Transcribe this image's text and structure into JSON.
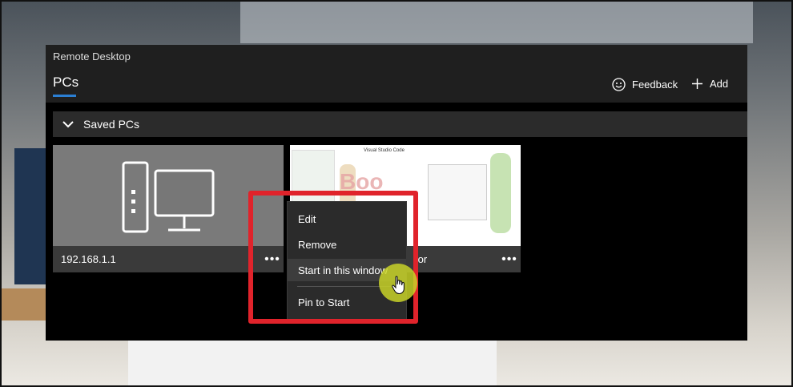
{
  "window": {
    "title": "Remote Desktop"
  },
  "header": {
    "tab": "PCs",
    "feedback_label": "Feedback",
    "add_label": "Add"
  },
  "group": {
    "label": "Saved PCs"
  },
  "tiles": [
    {
      "label": "192.168.1.1",
      "more": "•••"
    },
    {
      "label": "tor",
      "more": "•••"
    }
  ],
  "thumbnail": {
    "title": "Visual Studio Code",
    "brand": "Boo"
  },
  "context_menu": {
    "items": [
      "Edit",
      "Remove",
      "Start in this window",
      "Pin to Start"
    ],
    "hovered": "Start in this window"
  },
  "colors": {
    "accent": "#2b7fd3",
    "highlight": "#e0232b",
    "cursor_glow": "#c8d228"
  },
  "icons": [
    "feedback-smile-icon",
    "plus-icon",
    "chevron-down-icon",
    "pc-monitor-icon",
    "more-icon",
    "hand-cursor-icon"
  ]
}
